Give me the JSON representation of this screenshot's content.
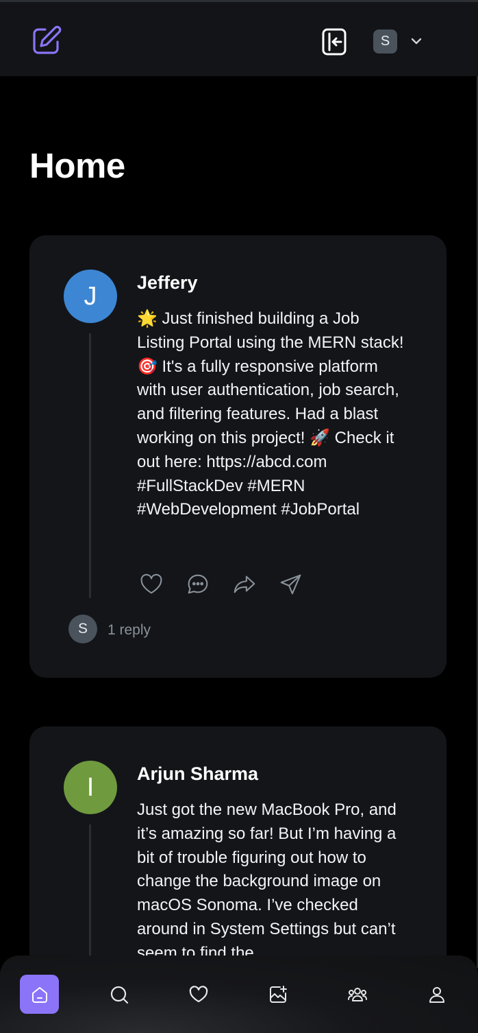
{
  "header": {
    "logo_icon": "compose-pen-icon",
    "logout_icon": "logout-icon",
    "user_initial": "S",
    "menu_icon": "chevron-down-icon",
    "accent_color": "#8b74f7"
  },
  "page": {
    "title": "Home"
  },
  "posts": [
    {
      "author": "Jeffery",
      "avatar_initial": "J",
      "avatar_color": "#3d86d4",
      "text": "🌟 Just finished building a Job Listing Portal using the MERN stack! 🎯 It's a fully responsive platform with user authentication, job search, and filtering features. Had a blast working on this project! 🚀 Check it out here: https://abcd.com #FullStackDev #MERN #WebDevelopment #JobPortal",
      "actions": [
        "heart-icon",
        "comment-icon",
        "repost-icon",
        "share-icon"
      ],
      "reply_avatar_initial": "S",
      "reply_count_label": "1 reply"
    },
    {
      "author": "Arjun Sharma",
      "avatar_initial": "I",
      "avatar_color": "#6f9a3e",
      "text": "Just got the new MacBook Pro, and it’s amazing so far! But I’m having a bit of trouble figuring out how to change the background image on macOS Sonoma. I’ve checked around in System Settings but can’t seem to find the"
    }
  ],
  "bottom_nav": {
    "items": [
      "home-icon",
      "search-icon",
      "heart-icon",
      "create-post-icon",
      "community-icon",
      "profile-icon"
    ],
    "active_index": 0
  }
}
